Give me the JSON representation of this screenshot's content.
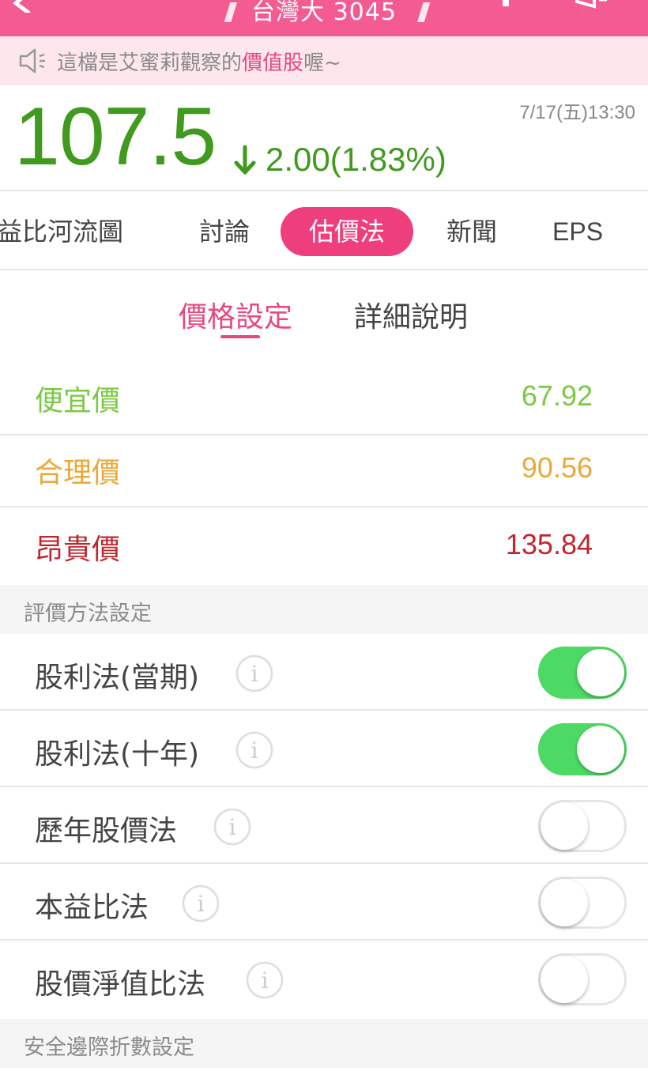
{
  "header": {
    "title": "台灣大 3045",
    "back_icon": "chevron-left-icon",
    "add_icon": "plus-icon",
    "share_icon": "megaphone-icon",
    "bar_color": "#f45b91"
  },
  "notice": {
    "icon": "speaker-icon",
    "prefix": "這檔是艾蜜莉觀察的",
    "highlight": "價值股",
    "suffix": "喔~"
  },
  "quote": {
    "price": "107.5",
    "change": "2.00(1.83%)",
    "direction": "down",
    "datetime": "7/17(五)13:30",
    "color": "#3f9a1e"
  },
  "tabs": [
    {
      "label": "益比河流圖",
      "active": false
    },
    {
      "label": "討論",
      "active": false
    },
    {
      "label": "估價法",
      "active": true
    },
    {
      "label": "新聞",
      "active": false
    },
    {
      "label": "EPS",
      "active": false
    }
  ],
  "subtabs": [
    {
      "label": "價格設定",
      "active": true
    },
    {
      "label": "詳細說明",
      "active": false
    }
  ],
  "prices": [
    {
      "label": "便宜價",
      "value": "67.92",
      "color": "#7ac943"
    },
    {
      "label": "合理價",
      "value": "90.56",
      "color": "#eba83a"
    },
    {
      "label": "昂貴價",
      "value": "135.84",
      "color": "#c0262d"
    }
  ],
  "sections": {
    "methods": "評價方法設定",
    "safety": "安全邊際折數設定"
  },
  "methods": [
    {
      "label": "股利法(當期)",
      "enabled": true
    },
    {
      "label": "股利法(十年)",
      "enabled": true
    },
    {
      "label": "歷年股價法",
      "enabled": false
    },
    {
      "label": "本益比法",
      "enabled": false
    },
    {
      "label": "股價淨值比法",
      "enabled": false
    }
  ]
}
